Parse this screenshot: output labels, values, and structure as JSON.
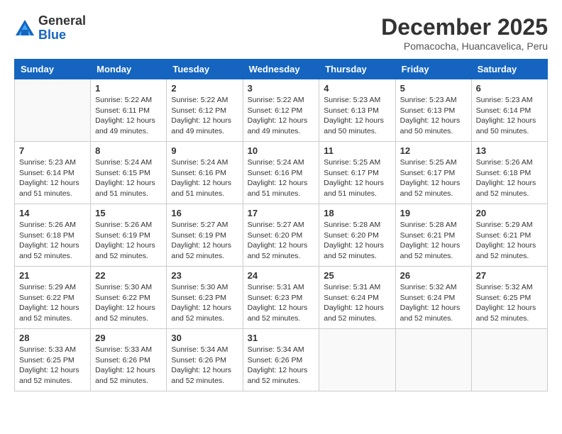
{
  "header": {
    "logo_line1": "General",
    "logo_line2": "Blue",
    "month_title": "December 2025",
    "location": "Pomacocha, Huancavelica, Peru"
  },
  "days_of_week": [
    "Sunday",
    "Monday",
    "Tuesday",
    "Wednesday",
    "Thursday",
    "Friday",
    "Saturday"
  ],
  "weeks": [
    [
      {
        "day": "",
        "sunrise": "",
        "sunset": "",
        "daylight": ""
      },
      {
        "day": "1",
        "sunrise": "Sunrise: 5:22 AM",
        "sunset": "Sunset: 6:11 PM",
        "daylight": "Daylight: 12 hours and 49 minutes."
      },
      {
        "day": "2",
        "sunrise": "Sunrise: 5:22 AM",
        "sunset": "Sunset: 6:12 PM",
        "daylight": "Daylight: 12 hours and 49 minutes."
      },
      {
        "day": "3",
        "sunrise": "Sunrise: 5:22 AM",
        "sunset": "Sunset: 6:12 PM",
        "daylight": "Daylight: 12 hours and 49 minutes."
      },
      {
        "day": "4",
        "sunrise": "Sunrise: 5:23 AM",
        "sunset": "Sunset: 6:13 PM",
        "daylight": "Daylight: 12 hours and 50 minutes."
      },
      {
        "day": "5",
        "sunrise": "Sunrise: 5:23 AM",
        "sunset": "Sunset: 6:13 PM",
        "daylight": "Daylight: 12 hours and 50 minutes."
      },
      {
        "day": "6",
        "sunrise": "Sunrise: 5:23 AM",
        "sunset": "Sunset: 6:14 PM",
        "daylight": "Daylight: 12 hours and 50 minutes."
      }
    ],
    [
      {
        "day": "7",
        "sunrise": "Sunrise: 5:23 AM",
        "sunset": "Sunset: 6:14 PM",
        "daylight": "Daylight: 12 hours and 51 minutes."
      },
      {
        "day": "8",
        "sunrise": "Sunrise: 5:24 AM",
        "sunset": "Sunset: 6:15 PM",
        "daylight": "Daylight: 12 hours and 51 minutes."
      },
      {
        "day": "9",
        "sunrise": "Sunrise: 5:24 AM",
        "sunset": "Sunset: 6:16 PM",
        "daylight": "Daylight: 12 hours and 51 minutes."
      },
      {
        "day": "10",
        "sunrise": "Sunrise: 5:24 AM",
        "sunset": "Sunset: 6:16 PM",
        "daylight": "Daylight: 12 hours and 51 minutes."
      },
      {
        "day": "11",
        "sunrise": "Sunrise: 5:25 AM",
        "sunset": "Sunset: 6:17 PM",
        "daylight": "Daylight: 12 hours and 51 minutes."
      },
      {
        "day": "12",
        "sunrise": "Sunrise: 5:25 AM",
        "sunset": "Sunset: 6:17 PM",
        "daylight": "Daylight: 12 hours and 52 minutes."
      },
      {
        "day": "13",
        "sunrise": "Sunrise: 5:26 AM",
        "sunset": "Sunset: 6:18 PM",
        "daylight": "Daylight: 12 hours and 52 minutes."
      }
    ],
    [
      {
        "day": "14",
        "sunrise": "Sunrise: 5:26 AM",
        "sunset": "Sunset: 6:18 PM",
        "daylight": "Daylight: 12 hours and 52 minutes."
      },
      {
        "day": "15",
        "sunrise": "Sunrise: 5:26 AM",
        "sunset": "Sunset: 6:19 PM",
        "daylight": "Daylight: 12 hours and 52 minutes."
      },
      {
        "day": "16",
        "sunrise": "Sunrise: 5:27 AM",
        "sunset": "Sunset: 6:19 PM",
        "daylight": "Daylight: 12 hours and 52 minutes."
      },
      {
        "day": "17",
        "sunrise": "Sunrise: 5:27 AM",
        "sunset": "Sunset: 6:20 PM",
        "daylight": "Daylight: 12 hours and 52 minutes."
      },
      {
        "day": "18",
        "sunrise": "Sunrise: 5:28 AM",
        "sunset": "Sunset: 6:20 PM",
        "daylight": "Daylight: 12 hours and 52 minutes."
      },
      {
        "day": "19",
        "sunrise": "Sunrise: 5:28 AM",
        "sunset": "Sunset: 6:21 PM",
        "daylight": "Daylight: 12 hours and 52 minutes."
      },
      {
        "day": "20",
        "sunrise": "Sunrise: 5:29 AM",
        "sunset": "Sunset: 6:21 PM",
        "daylight": "Daylight: 12 hours and 52 minutes."
      }
    ],
    [
      {
        "day": "21",
        "sunrise": "Sunrise: 5:29 AM",
        "sunset": "Sunset: 6:22 PM",
        "daylight": "Daylight: 12 hours and 52 minutes."
      },
      {
        "day": "22",
        "sunrise": "Sunrise: 5:30 AM",
        "sunset": "Sunset: 6:22 PM",
        "daylight": "Daylight: 12 hours and 52 minutes."
      },
      {
        "day": "23",
        "sunrise": "Sunrise: 5:30 AM",
        "sunset": "Sunset: 6:23 PM",
        "daylight": "Daylight: 12 hours and 52 minutes."
      },
      {
        "day": "24",
        "sunrise": "Sunrise: 5:31 AM",
        "sunset": "Sunset: 6:23 PM",
        "daylight": "Daylight: 12 hours and 52 minutes."
      },
      {
        "day": "25",
        "sunrise": "Sunrise: 5:31 AM",
        "sunset": "Sunset: 6:24 PM",
        "daylight": "Daylight: 12 hours and 52 minutes."
      },
      {
        "day": "26",
        "sunrise": "Sunrise: 5:32 AM",
        "sunset": "Sunset: 6:24 PM",
        "daylight": "Daylight: 12 hours and 52 minutes."
      },
      {
        "day": "27",
        "sunrise": "Sunrise: 5:32 AM",
        "sunset": "Sunset: 6:25 PM",
        "daylight": "Daylight: 12 hours and 52 minutes."
      }
    ],
    [
      {
        "day": "28",
        "sunrise": "Sunrise: 5:33 AM",
        "sunset": "Sunset: 6:25 PM",
        "daylight": "Daylight: 12 hours and 52 minutes."
      },
      {
        "day": "29",
        "sunrise": "Sunrise: 5:33 AM",
        "sunset": "Sunset: 6:26 PM",
        "daylight": "Daylight: 12 hours and 52 minutes."
      },
      {
        "day": "30",
        "sunrise": "Sunrise: 5:34 AM",
        "sunset": "Sunset: 6:26 PM",
        "daylight": "Daylight: 12 hours and 52 minutes."
      },
      {
        "day": "31",
        "sunrise": "Sunrise: 5:34 AM",
        "sunset": "Sunset: 6:26 PM",
        "daylight": "Daylight: 12 hours and 52 minutes."
      },
      {
        "day": "",
        "sunrise": "",
        "sunset": "",
        "daylight": ""
      },
      {
        "day": "",
        "sunrise": "",
        "sunset": "",
        "daylight": ""
      },
      {
        "day": "",
        "sunrise": "",
        "sunset": "",
        "daylight": ""
      }
    ]
  ]
}
